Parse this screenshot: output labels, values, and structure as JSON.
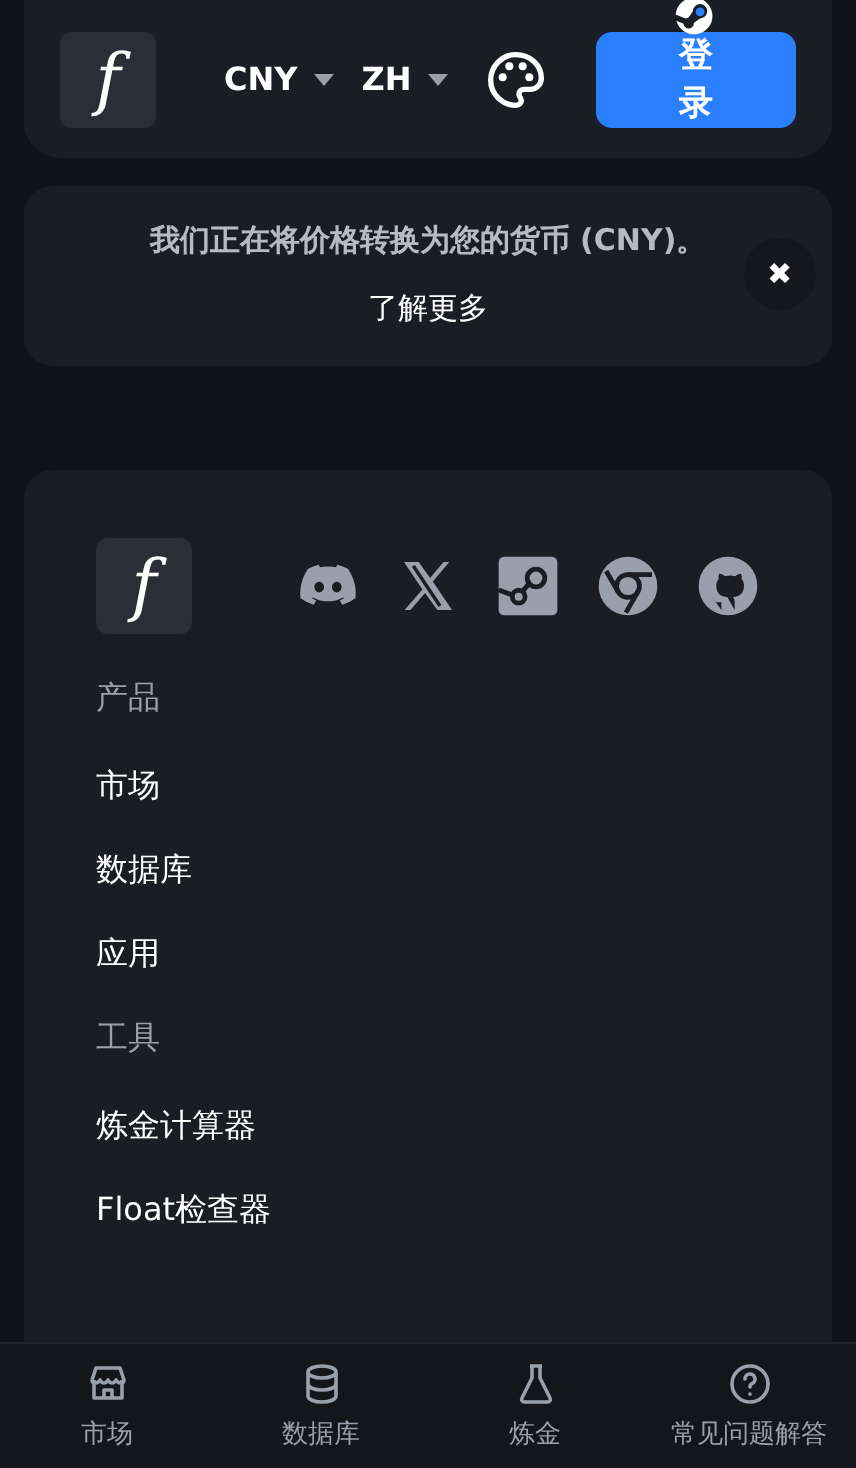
{
  "header": {
    "logo": "f",
    "currency": "CNY",
    "language": "ZH",
    "login": "登录"
  },
  "banner": {
    "message": "我们正在将价格转换为您的货币 (CNY)。",
    "link": "了解更多",
    "close": "✖"
  },
  "footer": {
    "logo": "f",
    "sections": [
      {
        "title": "产品",
        "links": [
          "市场",
          "数据库",
          "应用"
        ]
      },
      {
        "title": "工具",
        "links": [
          "炼金计算器",
          "Float检查器"
        ]
      }
    ]
  },
  "nav": [
    {
      "label": "市场",
      "kind": "store"
    },
    {
      "label": "数据库",
      "kind": "database"
    },
    {
      "label": "炼金",
      "kind": "flask"
    },
    {
      "label": "常见问题解答",
      "kind": "question"
    }
  ]
}
